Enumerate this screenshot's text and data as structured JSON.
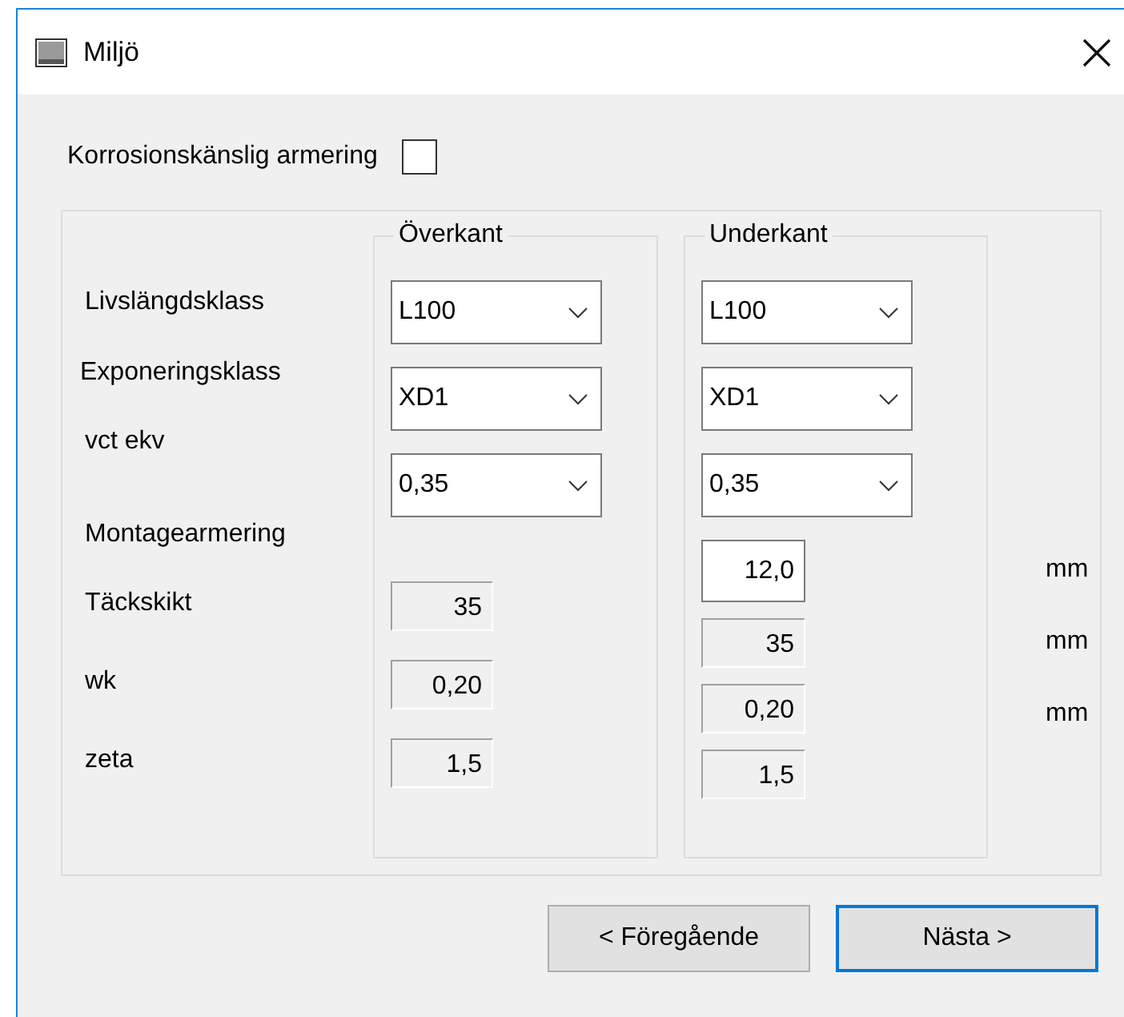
{
  "window": {
    "title": "Miljö"
  },
  "corrosion": {
    "label": "Korrosionskänslig armering",
    "checked": false
  },
  "row_labels": [
    "Livslängdsklass",
    "Exponeringsklass",
    "vct ekv",
    "Montagearmering",
    "Täckskikt",
    "wk",
    "zeta"
  ],
  "groups": [
    {
      "title": "Överkant",
      "selects": [
        "L100",
        "XD1",
        "0,35"
      ],
      "fields": [
        {
          "value": "35",
          "readonly": true
        },
        {
          "value": "0,20",
          "readonly": true
        },
        {
          "value": "1,5",
          "readonly": true
        }
      ]
    },
    {
      "title": "Underkant",
      "selects": [
        "L100",
        "XD1",
        "0,35"
      ],
      "fields": [
        {
          "value": "12,0",
          "readonly": false
        },
        {
          "value": "35",
          "readonly": true
        },
        {
          "value": "0,20",
          "readonly": true
        },
        {
          "value": "1,5",
          "readonly": true
        }
      ]
    }
  ],
  "units": [
    "mm",
    "mm",
    "mm"
  ],
  "buttons": [
    {
      "label": "< Föregående",
      "default": false
    },
    {
      "label": "Nästa >",
      "default": true
    }
  ]
}
